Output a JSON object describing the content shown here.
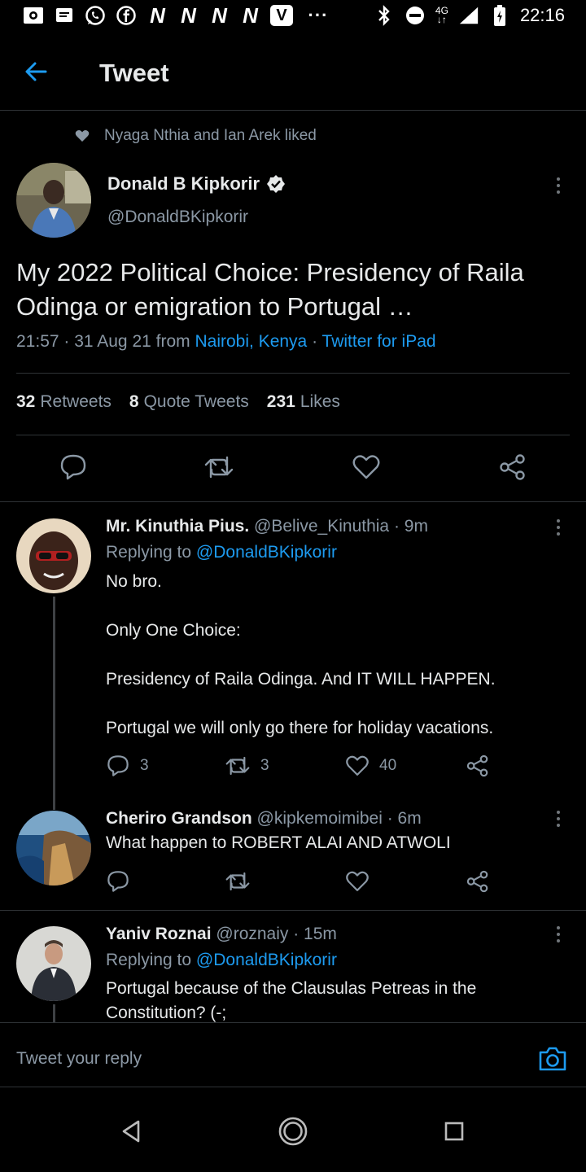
{
  "status_bar": {
    "time": "22:16",
    "network": "4G",
    "left_icons": [
      "screenshot-icon",
      "message-icon",
      "whatsapp-icon",
      "facebook-icon",
      "n-icon",
      "n-icon",
      "n-icon",
      "n-icon",
      "v-icon",
      "more-dots-icon"
    ],
    "right_icons": [
      "bluetooth-icon",
      "do-not-disturb-icon",
      "signal-icon",
      "battery-charging-icon"
    ]
  },
  "header": {
    "title": "Tweet"
  },
  "main_tweet": {
    "liked_by": "Nyaga Nthia and Ian Arek liked",
    "author_name": "Donald B Kipkorir",
    "author_handle": "@DonaldBKipkorir",
    "text": "My 2022 Political Choice: Presidency of Raila Odinga or emigration to Portugal …",
    "time": "21:57 · 31 Aug 21 from ",
    "location": "Nairobi, Kenya",
    "sep": " · ",
    "source": "Twitter for iPad",
    "stats": {
      "retweets_count": "32",
      "retweets_label": "Retweets",
      "quotes_count": "8",
      "quotes_label": "Quote Tweets",
      "likes_count": "231",
      "likes_label": "Likes"
    }
  },
  "replies": [
    {
      "name": "Mr. Kinuthia Pius.",
      "handle_time": " @Belive_Kinuthia · 9m",
      "replying_prefix": "Replying to ",
      "replying_to": "@DonaldBKipkorir",
      "lines": [
        "No bro.",
        "",
        "Only One Choice:",
        "",
        "Presidency of Raila Odinga. And IT WILL HAPPEN.",
        "",
        "Portugal we will only go there for holiday vacations."
      ],
      "reply_count": "3",
      "retweet_count": "3",
      "like_count": "40"
    },
    {
      "name": "Cheriro Grandson",
      "handle_time": " @kipkemoimibei · 6m",
      "lines": [
        "What happen to ROBERT ALAI AND ATWOLI"
      ]
    },
    {
      "name": "Yaniv Roznai",
      "handle_time": " @roznaiy · 15m",
      "replying_prefix": "Replying to ",
      "replying_to": "@DonaldBKipkorir",
      "lines": [
        "Portugal because of the Clausulas Petreas in the",
        "Constitution? (-;"
      ]
    }
  ],
  "composer": {
    "placeholder": "Tweet your reply"
  },
  "colors": {
    "accent": "#1d9bf0",
    "background": "#000000",
    "secondary_text": "#8b98a5",
    "divider": "#2f3336"
  }
}
